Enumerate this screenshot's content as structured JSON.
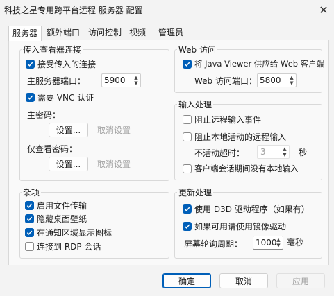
{
  "window": {
    "title": "科技之星专用跨平台远程 服务器 配置",
    "close_glyph": "✕"
  },
  "tabs": [
    {
      "label": "服务器",
      "active": true
    },
    {
      "label": "额外端口",
      "active": false
    },
    {
      "label": "访问控制",
      "active": false
    },
    {
      "label": "视频",
      "active": false
    },
    {
      "label": "管理员",
      "active": false
    }
  ],
  "incoming": {
    "title": "传入查看器连接",
    "accept": {
      "label": "接受传入的连接",
      "checked": true
    },
    "port_label": "主服务器端口：",
    "port_value": "5900",
    "vnc_auth": {
      "label": "需要 VNC 认证",
      "checked": true
    },
    "primary_password_label": "主密码：",
    "set_label": "设置...",
    "unset_label": "取消设置",
    "view_password_label": "仅查看密码：",
    "set2_label": "设置...",
    "unset2_label": "取消设置"
  },
  "web": {
    "title": "Web 访问",
    "serve": {
      "label": "将 Java Viewer 供应给 Web 客户端",
      "checked": true
    },
    "port_label": "Web 访问端口：",
    "port_value": "5800"
  },
  "input": {
    "title": "输入处理",
    "block_remote": {
      "label": "阻止远程输入事件",
      "checked": false
    },
    "block_local": {
      "label": "阻止本地活动的远程输入",
      "checked": false
    },
    "timeout_label": "不活动超时：",
    "timeout_value": "3",
    "timeout_unit": "秒",
    "no_local": {
      "label": "客户端会话期间没有本地输入",
      "checked": false
    }
  },
  "misc": {
    "title": "杂项",
    "file_transfer": {
      "label": "启用文件传输",
      "checked": true
    },
    "hide_wallpaper": {
      "label": "隐藏桌面壁纸",
      "checked": true
    },
    "tray_icon": {
      "label": "在通知区域显示图标",
      "checked": true
    },
    "rdp": {
      "label": "连接到 RDP 会话",
      "checked": false
    }
  },
  "update": {
    "title": "更新处理",
    "d3d": {
      "label": "使用 D3D 驱动程序（如果有）",
      "checked": true
    },
    "mirror": {
      "label": "如果可用请使用镜像驱动",
      "checked": true
    },
    "poll_label": "屏幕轮询周期：",
    "poll_value": "1000",
    "poll_unit": "毫秒"
  },
  "footer": {
    "ok": "确定",
    "cancel": "取消",
    "apply": "应用"
  },
  "colors": {
    "accent": "#005fb8",
    "disabled": "#a0a0a0"
  }
}
